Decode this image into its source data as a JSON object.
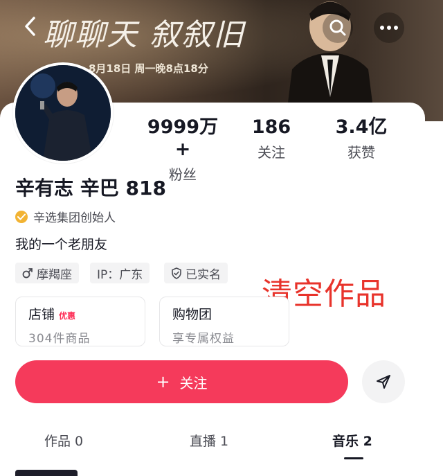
{
  "banner": {
    "title": "聊聊天 叙叙旧",
    "subtitle": "8月18日 周一晚8点18分"
  },
  "icons": {
    "back": "back-arrow-icon",
    "search": "search-icon",
    "more": "more-dots-icon",
    "verify": "verified-check-icon",
    "gender": "male-icon",
    "realname": "shield-check-icon",
    "share": "send-icon"
  },
  "stats": [
    {
      "value": "9999万+",
      "label": "粉丝"
    },
    {
      "value": "186",
      "label": "关注"
    },
    {
      "value": "3.4亿",
      "label": "获赞"
    }
  ],
  "profile": {
    "name": "辛有志 辛巴 818",
    "verification": "辛选集团创始人",
    "bio": "我的一个老朋友"
  },
  "tags": [
    {
      "label": "摩羯座"
    },
    {
      "label": "IP：广东"
    },
    {
      "label": "已实名"
    }
  ],
  "overlay_caption": "清空作品",
  "shops": [
    {
      "title": "店铺",
      "badge": "优惠",
      "subtitle": "304件商品"
    },
    {
      "title": "购物团",
      "badge": "",
      "subtitle": "享专属权益"
    }
  ],
  "actions": {
    "follow_plus": "+",
    "follow_label": "关注"
  },
  "tabs": [
    {
      "label": "作品 0",
      "active": false
    },
    {
      "label": "直播 1",
      "active": false
    },
    {
      "label": "音乐 2",
      "active": true
    }
  ],
  "colors": {
    "accent": "#f53a5b",
    "overlay_text": "#e8332b",
    "verify_badge": "#f2b333"
  }
}
